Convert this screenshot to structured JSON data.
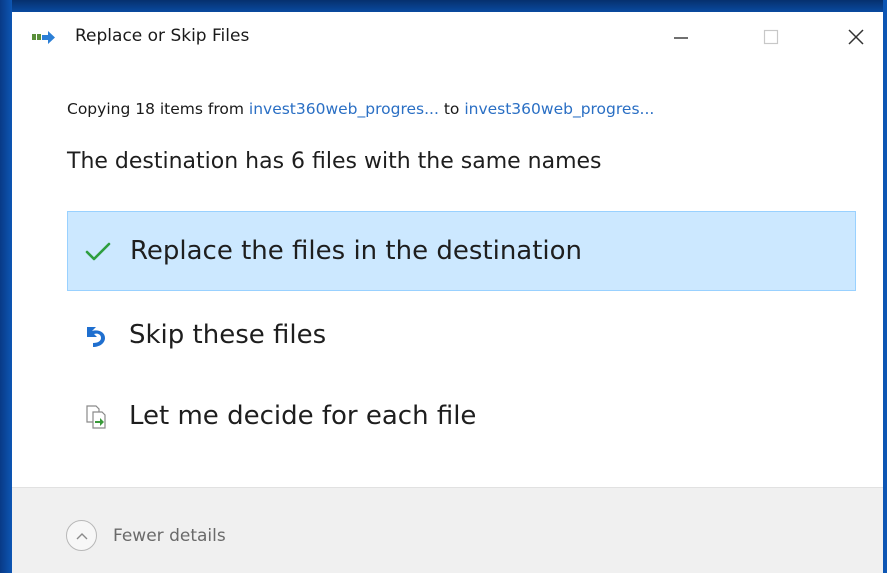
{
  "window": {
    "title": "Replace or Skip Files",
    "title_icon": "copy-files-arrow-icon",
    "controls": {
      "minimize_icon": "minimize-icon",
      "maximize_icon": "maximize-icon",
      "close_icon": "close-icon"
    }
  },
  "copy_info": {
    "prefix": "Copying 18 items from ",
    "source": "invest360web_progres...",
    "middle": " to ",
    "destination": "invest360web_progres..."
  },
  "headline": "The destination has 6 files with the same names",
  "options": [
    {
      "label": "Replace the files in the destination",
      "icon": "checkmark-icon",
      "selected": true
    },
    {
      "label": "Skip these files",
      "icon": "skip-arrow-icon",
      "selected": false
    },
    {
      "label": "Let me decide for each file",
      "icon": "compare-files-icon",
      "selected": false
    }
  ],
  "footer": {
    "details_label": "Fewer details",
    "details_icon": "chevron-up-icon"
  },
  "colors": {
    "link": "#2a6fc4",
    "selected_bg": "#cce8ff",
    "selected_border": "#99d1ff",
    "check_green": "#2e9e3f",
    "skip_blue": "#1f6fcf",
    "desktop_blue": "#0b4aa0"
  }
}
